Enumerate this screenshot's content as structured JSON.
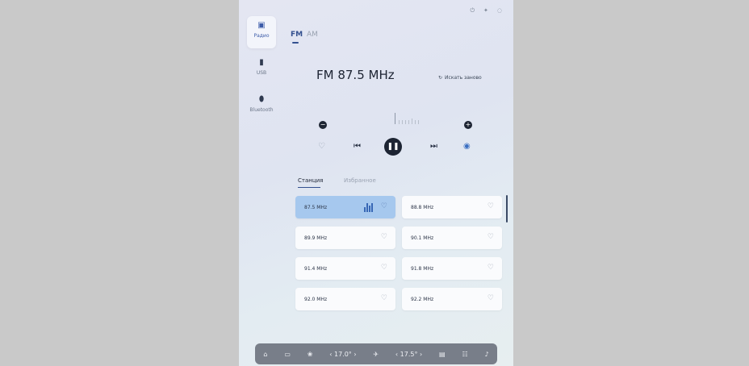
{
  "status_icons": [
    "power-icon",
    "dot-icon",
    "eye-off-icon"
  ],
  "sources": [
    {
      "label": "Радио",
      "icon": "radio-icon",
      "active": true
    },
    {
      "label": "USB",
      "icon": "usb-icon",
      "active": false
    },
    {
      "label": "Bluetooth",
      "icon": "bluetooth-icon",
      "active": false
    }
  ],
  "bands": {
    "fm": "FM",
    "am": "AM"
  },
  "frequency": "FM 87.5 MHz",
  "rescan": {
    "icon": "refresh-icon",
    "label": "Искать заново"
  },
  "tabs": {
    "stations": "Станция",
    "favorites": "Избранное"
  },
  "stations": [
    {
      "freq": "87.5  MHz",
      "active": true
    },
    {
      "freq": "88.8  MHz",
      "active": false
    },
    {
      "freq": "89.9  MHz",
      "active": false
    },
    {
      "freq": "90.1  MHz",
      "active": false
    },
    {
      "freq": "91.4  MHz",
      "active": false
    },
    {
      "freq": "91.8  MHz",
      "active": false
    },
    {
      "freq": "92.0  MHz",
      "active": false
    },
    {
      "freq": "92.2  MHz",
      "active": false
    }
  ],
  "dock": {
    "temp_left": "17.0°",
    "temp_right": "17.5°"
  },
  "colors": {
    "accent": "#33508f",
    "active_card": "#a6c8ee",
    "dock_bg": "#787e89"
  }
}
